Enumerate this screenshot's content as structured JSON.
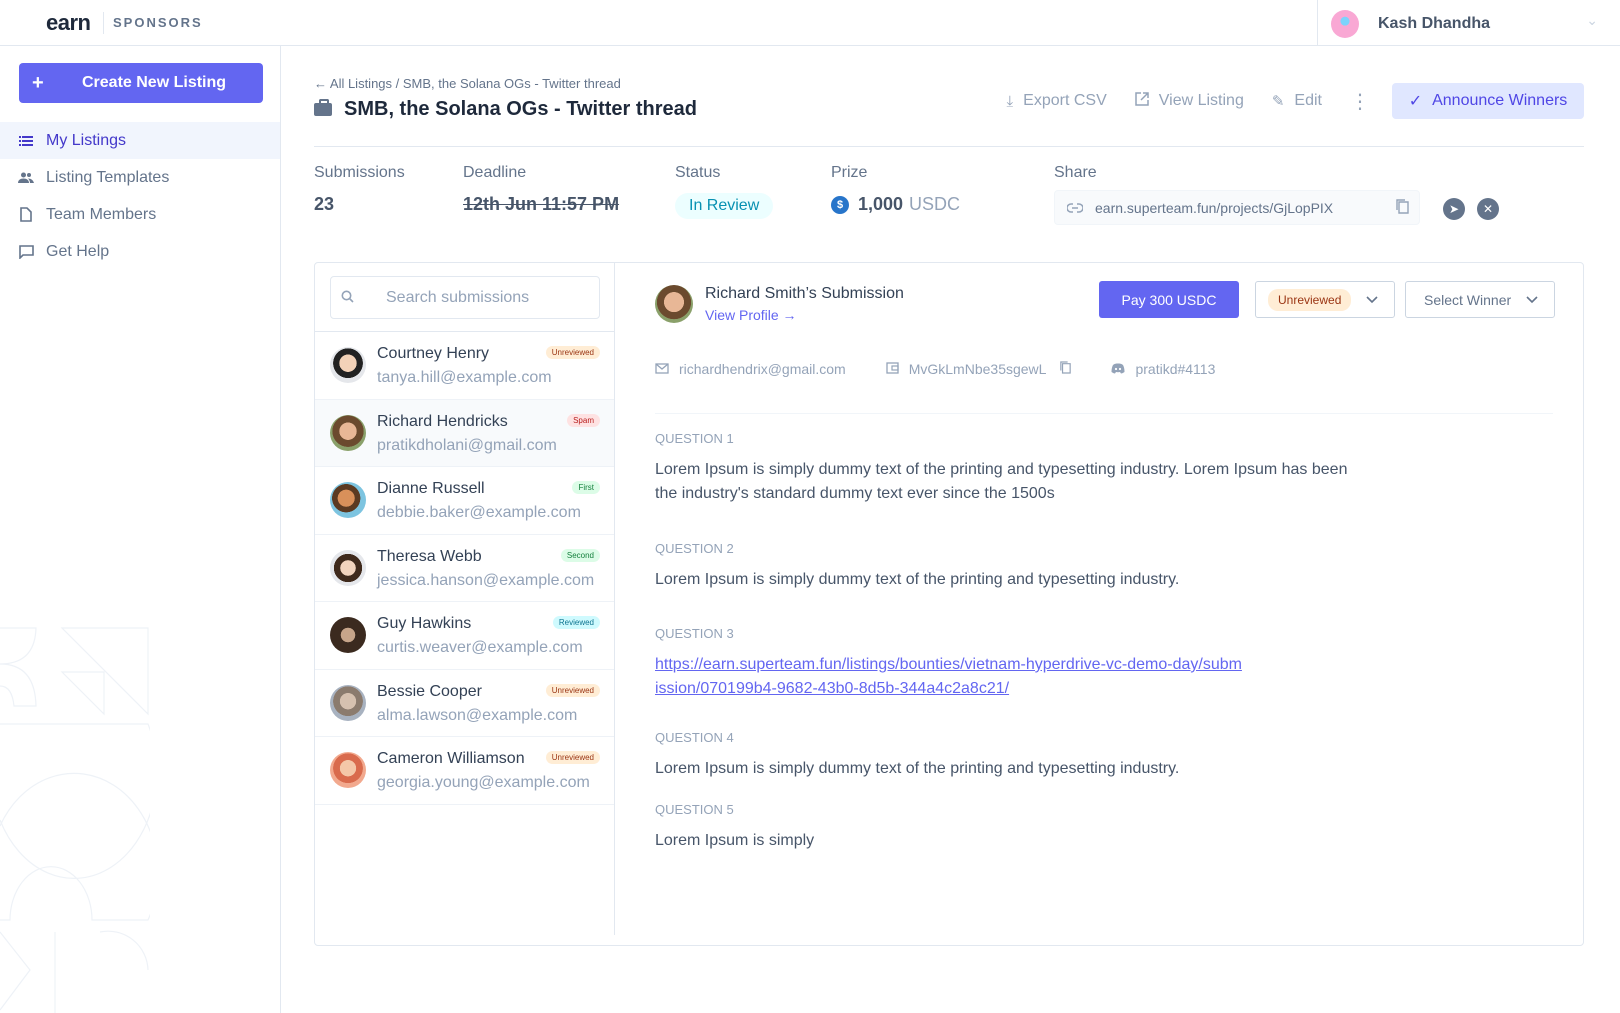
{
  "header": {
    "logo": "earn",
    "section": "SPONSORS",
    "user_name": "Kash Dhandha"
  },
  "sidebar": {
    "create_button": "Create New Listing",
    "items": [
      {
        "label": "My Listings",
        "icon": "list-icon",
        "active": true
      },
      {
        "label": "Listing Templates",
        "icon": "users-icon",
        "active": false
      },
      {
        "label": "Team Members",
        "icon": "file-icon",
        "active": false
      },
      {
        "label": "Get Help",
        "icon": "chat-icon",
        "active": false
      }
    ]
  },
  "listing": {
    "breadcrumb": "← All Listings / SMB, the Solana OGs - Twitter thread",
    "title": "SMB, the Solana OGs - Twitter thread",
    "actions": {
      "export": "Export CSV",
      "view": "View Listing",
      "edit": "Edit",
      "announce": "Announce Winners"
    },
    "stats": {
      "submissions_label": "Submissions",
      "submissions_value": "23",
      "deadline_label": "Deadline",
      "deadline_value": "12th Jun 11:57 PM",
      "status_label": "Status",
      "status_value": "In Review",
      "prize_label": "Prize",
      "prize_amount": "1,000",
      "prize_token": "USDC",
      "share_label": "Share",
      "share_url": "earn.superteam.fun/projects/GjLopPIX"
    }
  },
  "submissions": {
    "search_placeholder": "Search submissions",
    "list": [
      {
        "name": "Courtney Henry",
        "email": "tanya.hill@example.com",
        "tag": "Unreviewed"
      },
      {
        "name": "Richard Hendricks",
        "email": "pratikdholani@gmail.com",
        "tag": "Spam"
      },
      {
        "name": "Dianne Russell",
        "email": "debbie.baker@example.com",
        "tag": "First"
      },
      {
        "name": "Theresa Webb",
        "email": "jessica.hanson@example.com",
        "tag": "Second"
      },
      {
        "name": "Guy Hawkins",
        "email": "curtis.weaver@example.com",
        "tag": "Reviewed"
      },
      {
        "name": "Bessie Cooper",
        "email": "alma.lawson@example.com",
        "tag": "Unreviewed"
      },
      {
        "name": "Cameron Williamson",
        "email": "georgia.young@example.com",
        "tag": "Unreviewed"
      }
    ]
  },
  "detail": {
    "title": "Richard Smith’s Submission",
    "view_profile": "View Profile →",
    "pay_button": "Pay 300 USDC",
    "status_select": "Unreviewed",
    "winner_select": "Select Winner",
    "email": "richardhendrix@gmail.com",
    "wallet": "MvGkLmNbe35sgewL",
    "discord": "pratikd#4113",
    "questions": [
      {
        "label": "Question 1",
        "answer": "Lorem Ipsum is simply dummy text of the printing and typesetting industry. Lorem Ipsum has been the industry's standard dummy text ever since the 1500s"
      },
      {
        "label": "Question 2",
        "answer": "Lorem Ipsum is simply dummy text of the printing and typesetting industry."
      },
      {
        "label": "Question 3",
        "answer": "https://earn.superteam.fun/listings/bounties/vietnam-hyperdrive-vc-demo-day/submission/070199b4-9682-43b0-8d5b-344a4c2a8c21/",
        "is_link": true
      },
      {
        "label": "Question 4",
        "answer": "Lorem Ipsum is simply dummy text of the printing and typesetting industry."
      },
      {
        "label": "Question 5",
        "answer": "Lorem Ipsum is simply"
      }
    ]
  },
  "colors": {
    "accent": "#6366f1",
    "tag_unreviewed_bg": "#ffedd5",
    "tag_unreviewed_fg": "#9a3412",
    "tag_spam_bg": "#fee2e2",
    "tag_spam_fg": "#b91c1c",
    "tag_first_bg": "#dcfce7",
    "tag_first_fg": "#15803d",
    "tag_second_bg": "#dcfce7",
    "tag_second_fg": "#15803d",
    "tag_reviewed_bg": "#cffafe",
    "tag_reviewed_fg": "#0e7490"
  }
}
